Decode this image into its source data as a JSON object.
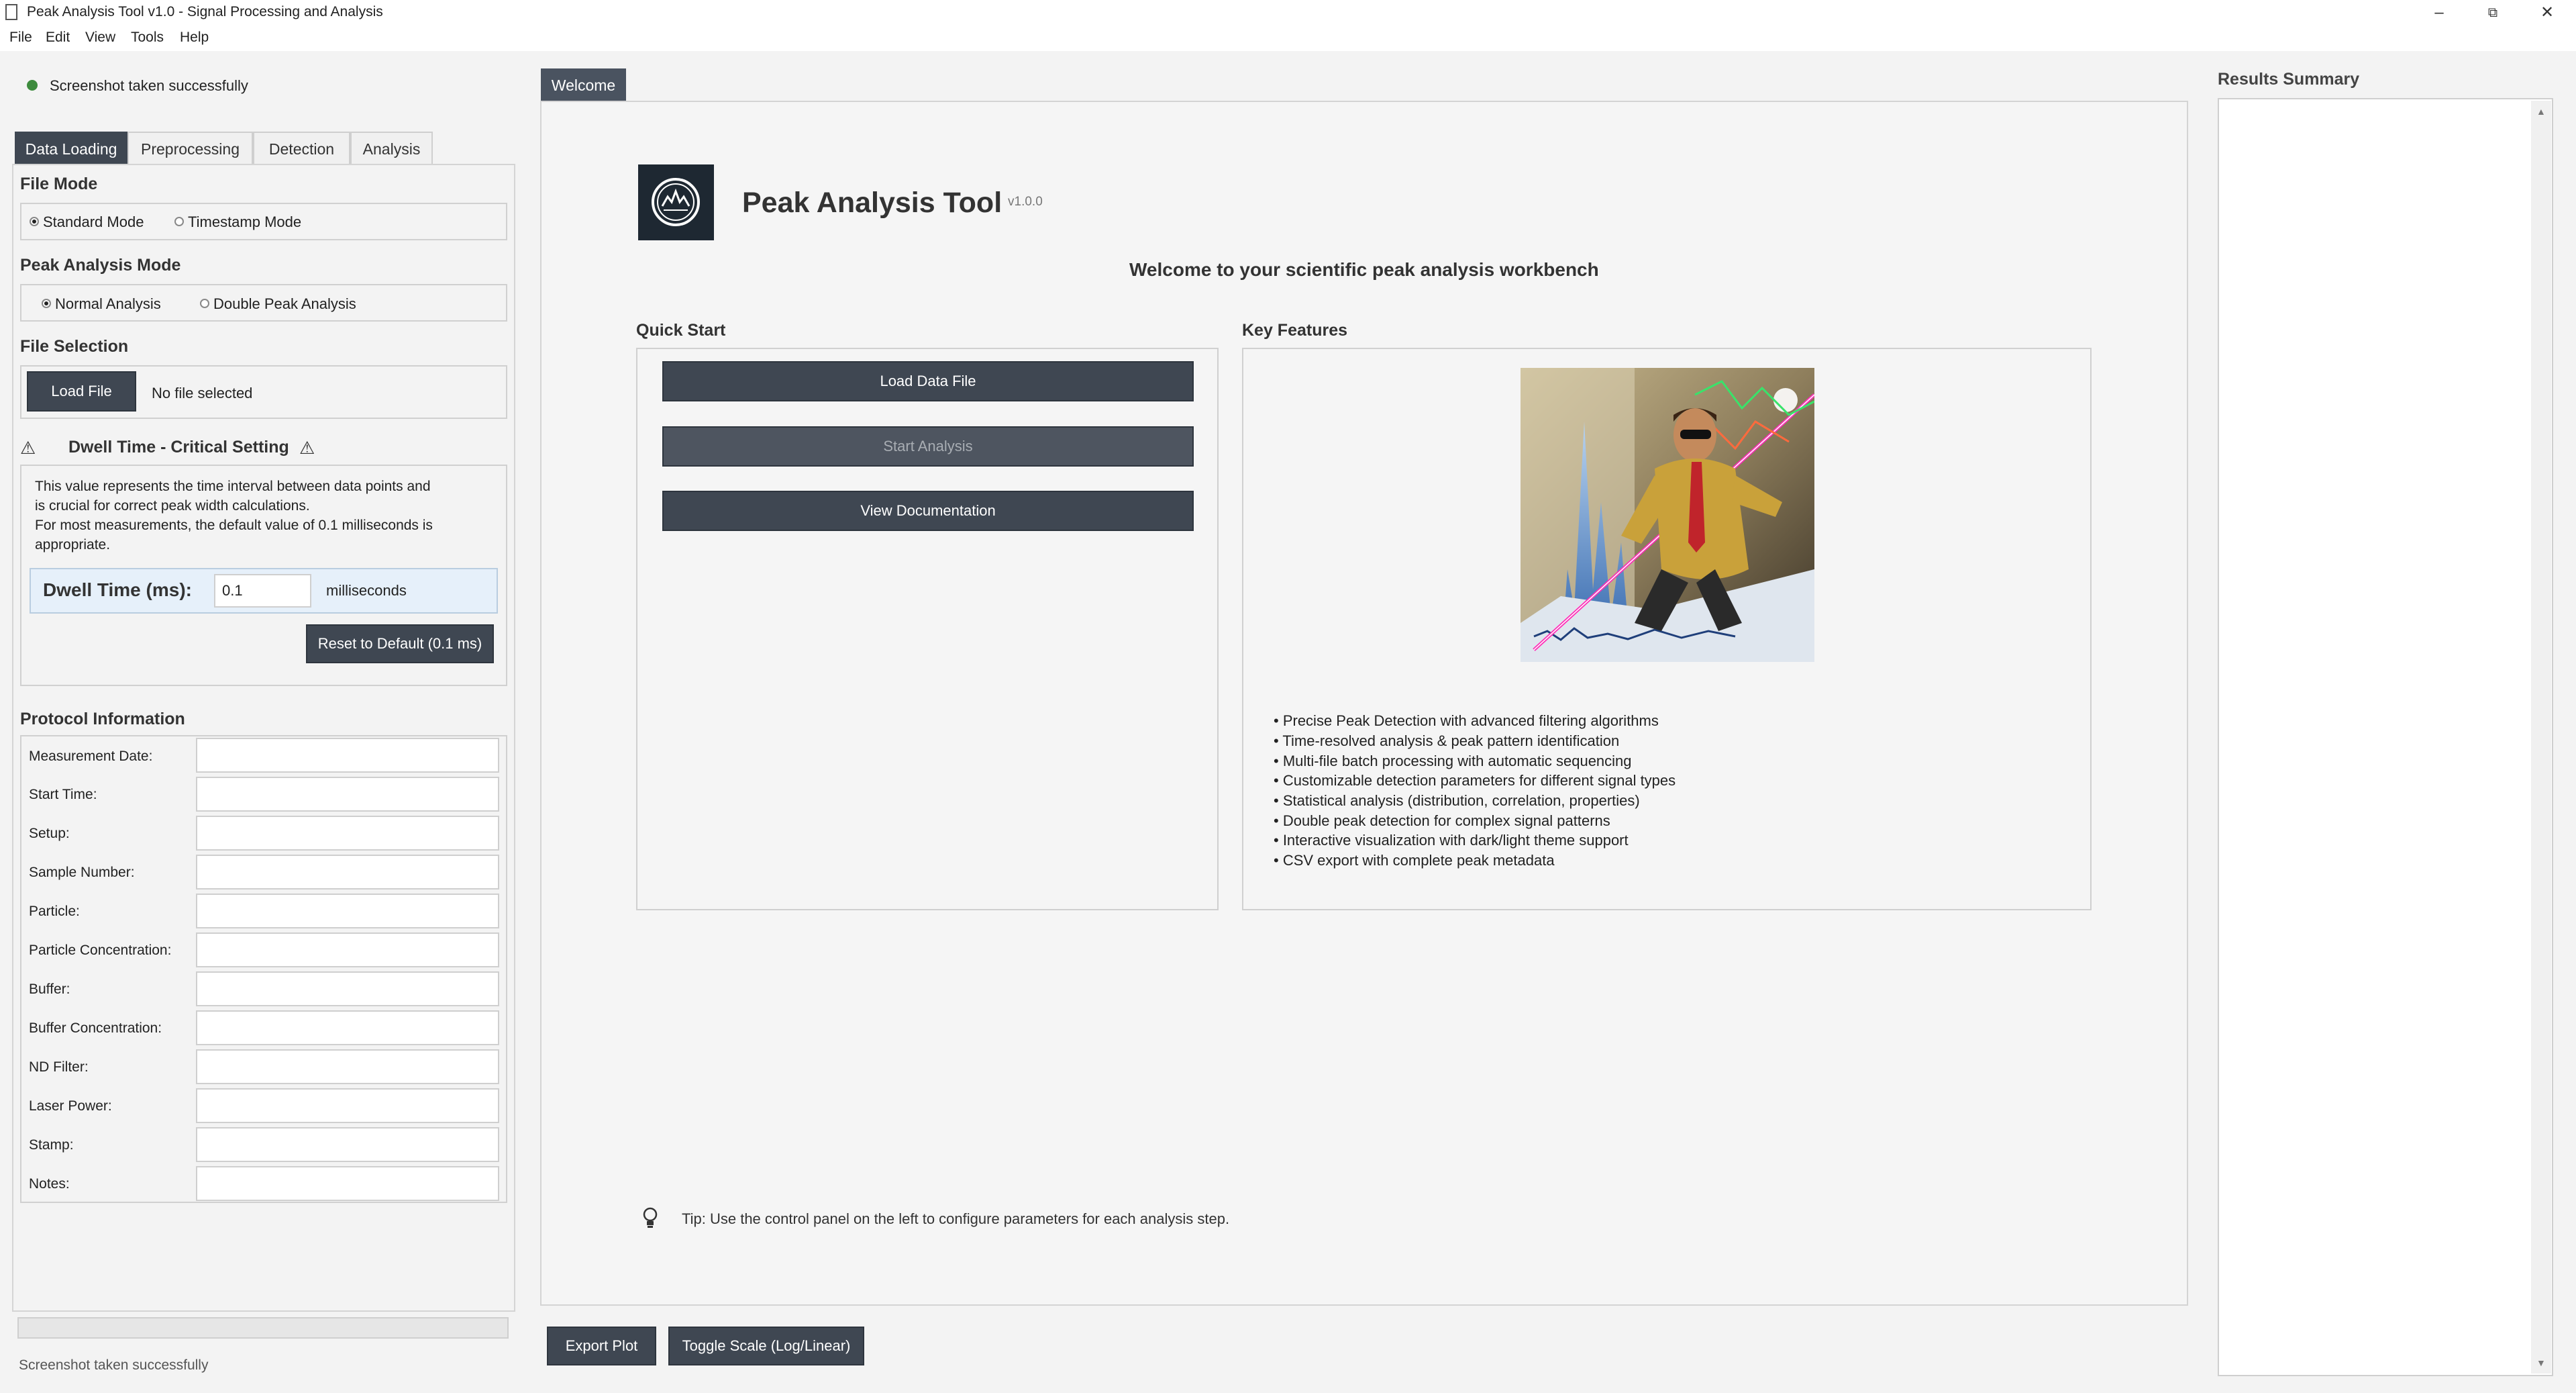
{
  "window": {
    "title": "Peak Analysis Tool v1.0 - Signal Processing and Analysis"
  },
  "menu": [
    "File",
    "Edit",
    "View",
    "Tools",
    "Help"
  ],
  "status": {
    "top": "Screenshot taken successfully",
    "bottom": "Screenshot taken successfully",
    "dot_color": "#3d8b3d"
  },
  "left_tabs": [
    "Data Loading",
    "Preprocessing",
    "Detection",
    "Analysis"
  ],
  "file_mode": {
    "title": "File Mode",
    "options": [
      "Standard Mode",
      "Timestamp Mode"
    ],
    "selected": "Standard Mode"
  },
  "peak_mode": {
    "title": "Peak Analysis Mode",
    "options": [
      "Normal Analysis",
      "Double Peak Analysis"
    ],
    "selected": "Normal Analysis"
  },
  "file_selection": {
    "title": "File Selection",
    "button": "Load File",
    "status": "No file selected"
  },
  "dwell": {
    "title": "Dwell Time - Critical Setting",
    "desc1": "This value represents the time interval between data points and",
    "desc2": "is crucial for correct peak width calculations.",
    "desc3": "For most measurements, the default value of 0.1 milliseconds is",
    "desc4": "appropriate.",
    "label": "Dwell Time (ms):",
    "value": "0.1",
    "unit": "milliseconds",
    "reset": "Reset to Default (0.1 ms)"
  },
  "protocol": {
    "title": "Protocol Information",
    "fields": [
      "Measurement Date:",
      "Start Time:",
      "Setup:",
      "Sample Number:",
      "Particle:",
      "Particle Concentration:",
      "Buffer:",
      "Buffer Concentration:",
      "ND Filter:",
      "Laser Power:",
      "Stamp:",
      "Notes:"
    ]
  },
  "center": {
    "tab": "Welcome",
    "app_name": "Peak Analysis Tool",
    "version": "v1.0.0",
    "welcome": "Welcome to your scientific peak analysis workbench",
    "quick_start": "Quick Start",
    "key_features": "Key Features",
    "buttons": [
      "Load Data File",
      "Start Analysis",
      "View Documentation"
    ],
    "features": [
      "• Precise Peak Detection with advanced filtering algorithms",
      "• Time-resolved analysis & peak pattern identification",
      "• Multi-file batch processing with automatic sequencing",
      "• Customizable detection parameters for different signal types",
      "• Statistical analysis (distribution, correlation, properties)",
      "• Double peak detection for complex signal patterns",
      "• Interactive visualization with dark/light theme support",
      "• CSV export with complete peak metadata"
    ],
    "tip": "Tip: Use the control panel on the left to configure parameters for each analysis step."
  },
  "bottom_buttons": [
    "Export Plot",
    "Toggle Scale (Log/Linear)"
  ],
  "results": {
    "title": "Results Summary"
  },
  "colors": {
    "dark_button": "#3f4752",
    "accent_magenta": "#ff2fb8"
  }
}
